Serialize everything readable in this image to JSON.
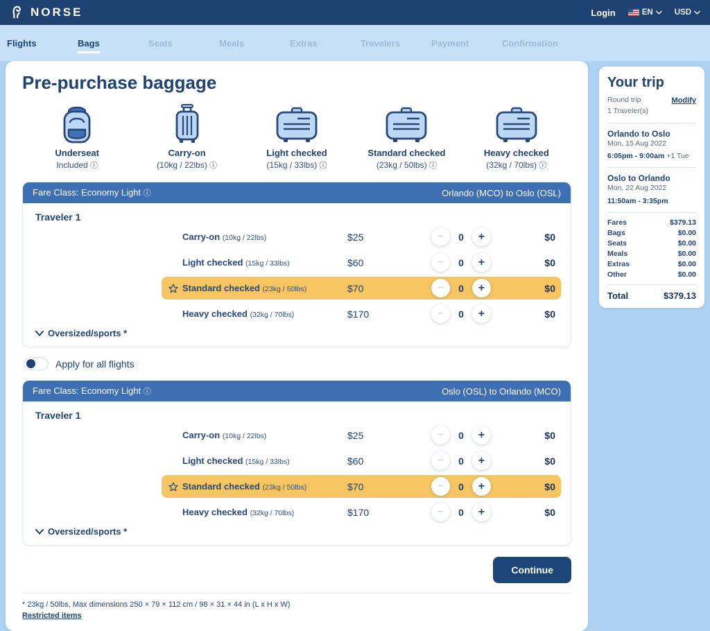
{
  "header": {
    "brand": "NORSE",
    "login_label": "Login",
    "language": "EN",
    "currency": "USD"
  },
  "nav": {
    "tabs": [
      {
        "label": "Flights"
      },
      {
        "label": "Bags"
      },
      {
        "label": "Seats"
      },
      {
        "label": "Meals"
      },
      {
        "label": "Extras"
      },
      {
        "label": "Travelers"
      },
      {
        "label": "Payment"
      },
      {
        "label": "Confirmation"
      }
    ]
  },
  "page": {
    "title": "Pre-purchase baggage"
  },
  "glyphs": {
    "info": "ⓘ",
    "minus": "−",
    "plus": "+"
  },
  "bag_types": [
    {
      "name": "Underseat",
      "detail": "Included"
    },
    {
      "name": "Carry-on",
      "detail": "(10kg / 22lbs)"
    },
    {
      "name": "Light checked",
      "detail": "(15kg / 33lbs)"
    },
    {
      "name": "Standard checked",
      "detail": "(23kg / 50lbs)"
    },
    {
      "name": "Heavy checked",
      "detail": "(32kg / 70lbs)"
    }
  ],
  "sections": [
    {
      "fare_label": "Fare Class: Economy Light",
      "route": "Orlando (MCO) to Oslo (OSL)",
      "traveler": "Traveler 1",
      "oversized_label": "Oversized/sports *",
      "rows": [
        {
          "label": "Carry-on",
          "weight": "(10kg / 22lbs)",
          "price": "$25",
          "qty": "0",
          "total": "$0",
          "highlighted": false
        },
        {
          "label": "Light checked",
          "weight": "(15kg / 33lbs)",
          "price": "$60",
          "qty": "0",
          "total": "$0",
          "highlighted": false
        },
        {
          "label": "Standard checked",
          "weight": "(23kg / 50lbs)",
          "price": "$70",
          "qty": "0",
          "total": "$0",
          "highlighted": true
        },
        {
          "label": "Heavy checked",
          "weight": "(32kg / 70lbs)",
          "price": "$170",
          "qty": "0",
          "total": "$0",
          "highlighted": false
        }
      ]
    },
    {
      "fare_label": "Fare Class: Economy Light",
      "route": "Oslo (OSL) to Orlando (MCO)",
      "traveler": "Traveler 1",
      "oversized_label": "Oversized/sports *",
      "rows": [
        {
          "label": "Carry-on",
          "weight": "(10kg / 22lbs)",
          "price": "$25",
          "qty": "0",
          "total": "$0",
          "highlighted": false
        },
        {
          "label": "Light checked",
          "weight": "(15kg / 33lbs)",
          "price": "$60",
          "qty": "0",
          "total": "$0",
          "highlighted": false
        },
        {
          "label": "Standard checked",
          "weight": "(23kg / 50lbs)",
          "price": "$70",
          "qty": "0",
          "total": "$0",
          "highlighted": true
        },
        {
          "label": "Heavy checked",
          "weight": "(32kg / 70lbs)",
          "price": "$170",
          "qty": "0",
          "total": "$0",
          "highlighted": false
        }
      ]
    }
  ],
  "toggle": {
    "label": "Apply for all flights"
  },
  "continue_label": "Continue",
  "footnote": {
    "text": "* 23kg / 50lbs, Max dimensions 250 × 79 × 112 cm / 98 × 31 × 44 in (L x H x W)",
    "link": "Restricted items"
  },
  "sidebar": {
    "title": "Your trip",
    "trip_type": "Round trip",
    "modify_label": "Modify",
    "travelers": "1 Traveler(s)",
    "legs": [
      {
        "route": "Orlando to Oslo",
        "date": "Mon, 15 Aug 2022",
        "time": "6:05pm - 9:00am",
        "suffix": " +1 Tue"
      },
      {
        "route": "Oslo to Orlando",
        "date": "Mon, 22 Aug 2022",
        "time": "11:50am - 3:35pm",
        "suffix": ""
      }
    ],
    "fees": [
      {
        "label": "Fares",
        "value": "$379.13"
      },
      {
        "label": "Bags",
        "value": "$0.00"
      },
      {
        "label": "Seats",
        "value": "$0.00"
      },
      {
        "label": "Meals",
        "value": "$0.00"
      },
      {
        "label": "Extras",
        "value": "$0.00"
      },
      {
        "label": "Other",
        "value": "$0.00"
      }
    ],
    "total_label": "Total",
    "total_value": "$379.13"
  },
  "colors": {
    "header_navy": "#1d4271",
    "fare_bar_blue": "#3e6fb3",
    "highlight_orange": "#f7c561",
    "page_bg": "#aed2f1",
    "button_navy": "#1c4678"
  }
}
